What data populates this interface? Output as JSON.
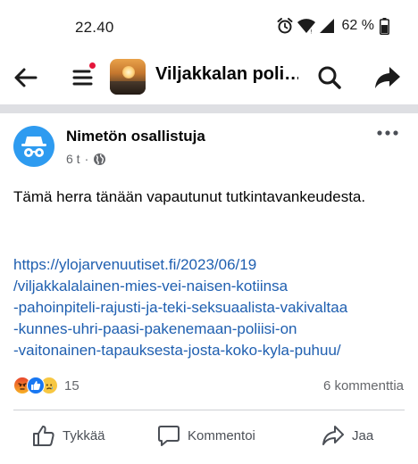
{
  "status_bar": {
    "time": "22.40",
    "battery_percent": "62 %",
    "icons": [
      "alarm-icon",
      "wifi-icon",
      "signal-icon",
      "battery-icon"
    ]
  },
  "app_bar": {
    "group_name": "Viljakkalan poli…",
    "icons": [
      "back-arrow-icon",
      "menu-icon",
      "search-icon",
      "share-arrow-icon"
    ],
    "menu_notification": true
  },
  "post": {
    "author": "Nimetön osallistuja",
    "avatar_icon": "incognito-icon",
    "time": "6 t",
    "separator": "·",
    "privacy_icon": "globe-icon",
    "more_icon": "more-dots-icon",
    "text": "Tämä herra tänään vapautunut tutkintavankeudesta.",
    "link_lines": [
      "https://ylojarvenuutiset.fi/2023/06/19",
      "/viljakkalalainen-mies-vei-naisen-kotiinsa",
      "-pahoinpiteli-rajusti-ja-teki-seksuaalista-vakivaltaa",
      "-kunnes-uhri-paasi-pakenemaan-poliisi-on",
      "-vaitonainen-tapauksesta-josta-koko-kyla-puhuu/"
    ],
    "reactions": [
      "angry-reaction-icon",
      "like-reaction-icon",
      "sad-reaction-icon"
    ],
    "reaction_count": "15",
    "comment_count": "6 kommenttia"
  },
  "actions": {
    "like": "Tykkää",
    "comment": "Kommentoi",
    "share": "Jaa"
  },
  "colors": {
    "link": "#1f5fb0",
    "accent": "#1877f2",
    "avatar": "#2e9bf0",
    "notification_dot": "#e4163a",
    "secondary_text": "#65676b"
  }
}
